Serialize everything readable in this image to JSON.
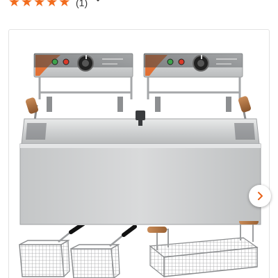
{
  "rating": {
    "stars": [
      "★",
      "★",
      "★",
      "★",
      "★"
    ],
    "review_count": "(1)",
    "star_color": "#f26c1d",
    "expand_icon": "chevron-down-icon"
  },
  "gallery": {
    "main_image": "double-tank-electric-deep-fryer",
    "next_icon": "chevron-right-icon",
    "accent": "#e8621a",
    "thumbnails": [
      "two-square-fryer-baskets",
      "long-fryer-basket"
    ]
  }
}
